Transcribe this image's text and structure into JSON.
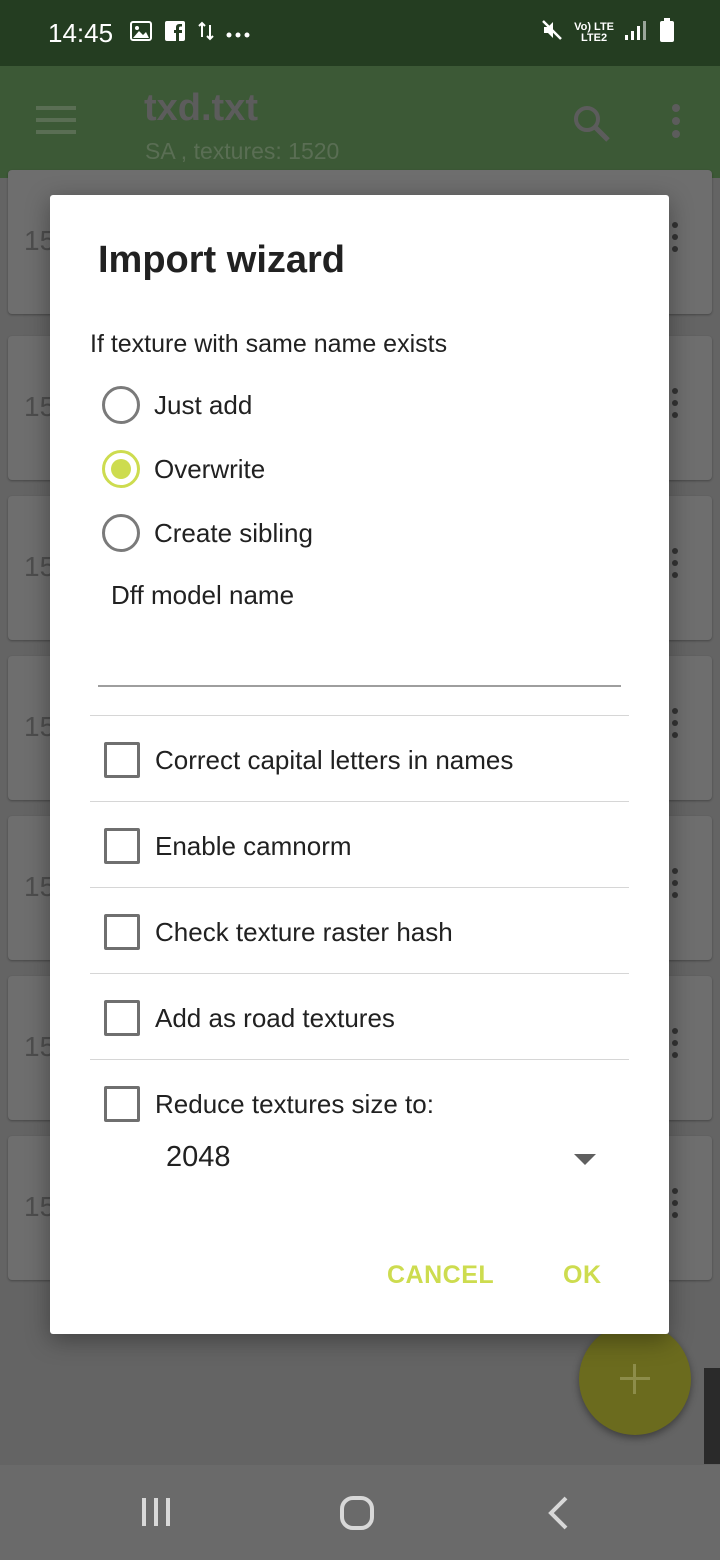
{
  "status_bar": {
    "time": "14:45",
    "left_icons": [
      "image-icon",
      "facebook-icon",
      "data-transfer-icon",
      "more-dots-icon"
    ],
    "lte_text_top": "Vo) LTE",
    "lte_text_bottom": "LTE2",
    "right_icons": [
      "mute-icon",
      "volte-icon",
      "signal-icon",
      "battery-icon"
    ]
  },
  "app_bar": {
    "title": "txd.txt",
    "subtitle": "SA , textures: 1520",
    "icons": [
      "menu-icon",
      "search-icon",
      "more-vert-icon"
    ]
  },
  "background_list": {
    "items": [
      {
        "number": "15"
      },
      {
        "number": "15"
      },
      {
        "number": "15"
      },
      {
        "number": "15"
      },
      {
        "number": "15"
      },
      {
        "number": "15"
      },
      {
        "number": "15"
      }
    ]
  },
  "dialog": {
    "title": "Import wizard",
    "section_label": "If texture with same name exists",
    "radios": [
      {
        "label": "Just add",
        "checked": false
      },
      {
        "label": "Overwrite",
        "checked": true
      },
      {
        "label": "Create sibling",
        "checked": false
      }
    ],
    "dff_label": "Dff model name",
    "dff_value": "",
    "checkboxes": [
      {
        "label": "Correct capital letters in names",
        "checked": false
      },
      {
        "label": "Enable camnorm",
        "checked": false
      },
      {
        "label": "Check texture raster hash",
        "checked": false
      },
      {
        "label": "Add as road textures",
        "checked": false
      },
      {
        "label": "Reduce textures size to:",
        "checked": false
      }
    ],
    "size_select_value": "2048",
    "cancel_label": "CANCEL",
    "ok_label": "OK"
  },
  "fab": {
    "icon": "plus-icon"
  },
  "nav_bar": {
    "icons": [
      "recents-icon",
      "home-icon",
      "back-icon"
    ]
  },
  "colors": {
    "accent": "#cddc4f",
    "status_bar_bg": "#243d21",
    "app_bar_bg": "#3c5936",
    "dialog_bg": "#ffffff",
    "scrim": "#6b6b6b"
  }
}
